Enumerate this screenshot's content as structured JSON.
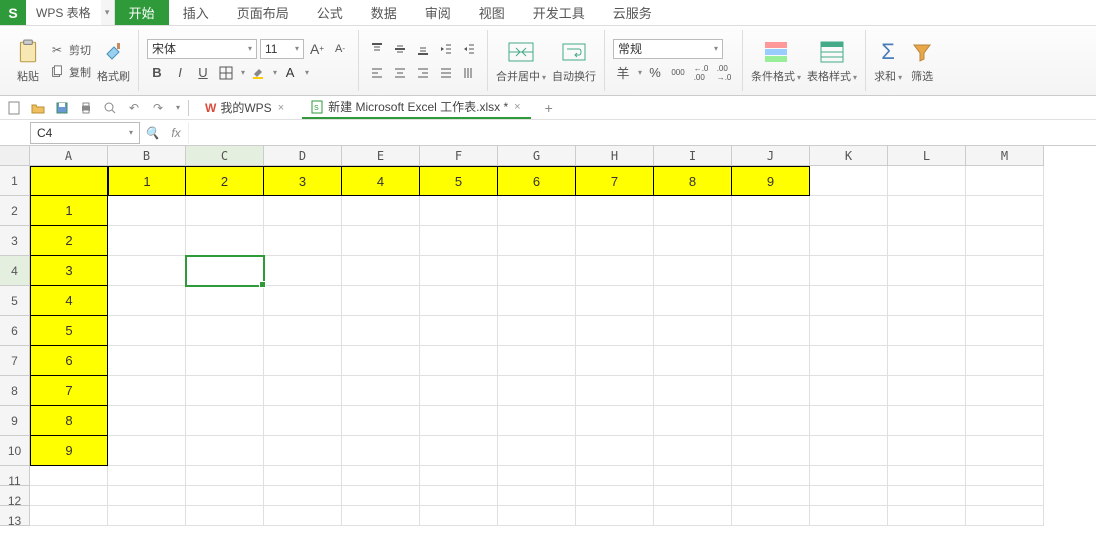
{
  "app": {
    "icon": "S",
    "name": "WPS 表格"
  },
  "menu_tabs": [
    "开始",
    "插入",
    "页面布局",
    "公式",
    "数据",
    "审阅",
    "视图",
    "开发工具",
    "云服务"
  ],
  "active_tab": 0,
  "ribbon": {
    "paste": "粘贴",
    "cut": "剪切",
    "copy": "复制",
    "format_painter": "格式刷",
    "font_family": "宋体",
    "font_size": "11",
    "merge": "合并居中",
    "wrap": "自动换行",
    "number_format": "常规",
    "percent": "%",
    "comma": ",",
    "cond_fmt": "条件格式",
    "table_style": "表格样式",
    "sum": "求和",
    "filter": "筛选"
  },
  "doc_tabs": {
    "home": "我的WPS",
    "file": "新建 Microsoft Excel 工作表.xlsx *"
  },
  "namebox": "C4",
  "fx_label": "fx",
  "columns": [
    "A",
    "B",
    "C",
    "D",
    "E",
    "F",
    "G",
    "H",
    "I",
    "J",
    "K",
    "L",
    "M"
  ],
  "row_count": 13,
  "row1": [
    "",
    "1",
    "2",
    "3",
    "4",
    "5",
    "6",
    "7",
    "8",
    "9"
  ],
  "colA": [
    "",
    "1",
    "2",
    "3",
    "4",
    "5",
    "6",
    "7",
    "8",
    "9"
  ],
  "selected": {
    "col": 2,
    "row": 4
  },
  "currency_symbol": "羊",
  "inc_dec": {
    "inc": ".00",
    "dec": ".0"
  }
}
